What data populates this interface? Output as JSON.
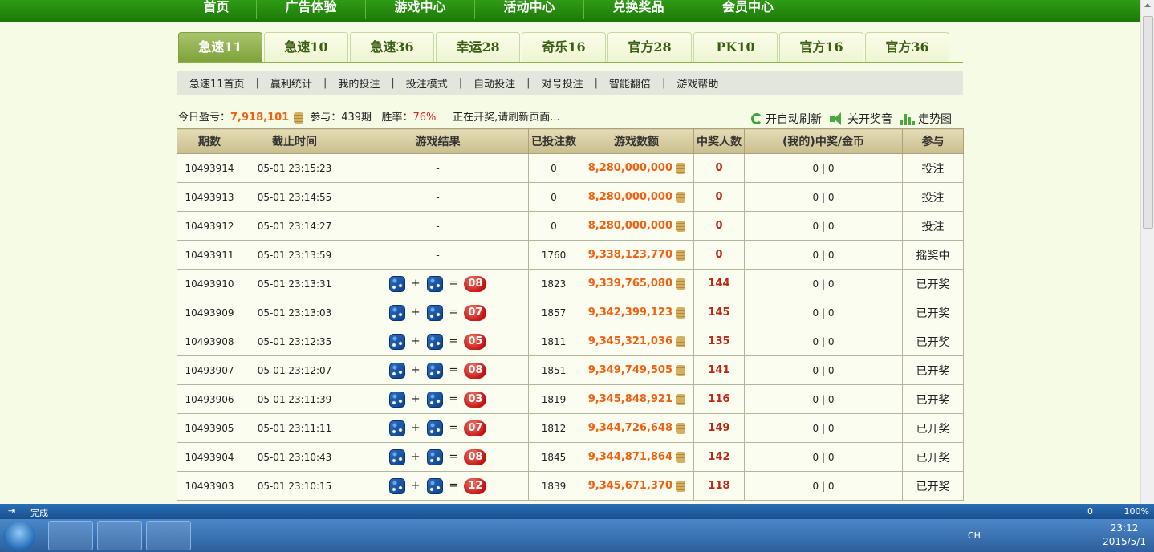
{
  "nav": [
    "首页",
    "广告体验",
    "游戏中心",
    "活动中心",
    "兑换奖品",
    "会员中心"
  ],
  "game_tabs": [
    "急速11",
    "急速10",
    "急速36",
    "幸运28",
    "奇乐16",
    "官方28",
    "PK10",
    "官方16",
    "官方36"
  ],
  "submenu": [
    "急速11首页",
    "赢利统计",
    "我的投注",
    "投注模式",
    "自动投注",
    "对号投注",
    "智能翻倍",
    "游戏帮助"
  ],
  "stats": {
    "label_profit": "今日盈亏：",
    "profit": "7,918,101",
    "label_join": "参与：",
    "join": "439期",
    "label_rate": "胜率：",
    "rate": "76%",
    "notice": "正在开奖,请刷新页面..."
  },
  "tools": {
    "refresh": "开自动刷新",
    "sound": "关开奖音",
    "trend": "走势图"
  },
  "table": {
    "headers": [
      "期数",
      "截止时间",
      "游戏结果",
      "已投注数",
      "游戏数额",
      "中奖人数",
      "(我的)中奖/金币",
      "参与"
    ],
    "rows": [
      {
        "id": "10493914",
        "time": "05-01 23:15:23",
        "result": "-",
        "bets": "0",
        "amount": "8,280,000,000",
        "winners": "0",
        "mine": "0 | 0",
        "status": "投注"
      },
      {
        "id": "10493913",
        "time": "05-01 23:14:55",
        "result": "-",
        "bets": "0",
        "amount": "8,280,000,000",
        "winners": "0",
        "mine": "0 | 0",
        "status": "投注"
      },
      {
        "id": "10493912",
        "time": "05-01 23:14:27",
        "result": "-",
        "bets": "0",
        "amount": "8,280,000,000",
        "winners": "0",
        "mine": "0 | 0",
        "status": "投注"
      },
      {
        "id": "10493911",
        "time": "05-01 23:13:59",
        "result": "-",
        "bets": "1760",
        "amount": "9,338,123,770",
        "winners": "0",
        "mine": "0 | 0",
        "status": "摇奖中"
      },
      {
        "id": "10493910",
        "time": "05-01 23:13:31",
        "result": "08",
        "bets": "1823",
        "amount": "9,339,765,080",
        "winners": "144",
        "mine": "0 | 0",
        "status": "已开奖"
      },
      {
        "id": "10493909",
        "time": "05-01 23:13:03",
        "result": "07",
        "bets": "1857",
        "amount": "9,342,399,123",
        "winners": "145",
        "mine": "0 | 0",
        "status": "已开奖"
      },
      {
        "id": "10493908",
        "time": "05-01 23:12:35",
        "result": "05",
        "bets": "1811",
        "amount": "9,345,321,036",
        "winners": "135",
        "mine": "0 | 0",
        "status": "已开奖"
      },
      {
        "id": "10493907",
        "time": "05-01 23:12:07",
        "result": "08",
        "bets": "1851",
        "amount": "9,349,749,505",
        "winners": "141",
        "mine": "0 | 0",
        "status": "已开奖"
      },
      {
        "id": "10493906",
        "time": "05-01 23:11:39",
        "result": "03",
        "bets": "1819",
        "amount": "9,345,848,921",
        "winners": "116",
        "mine": "0 | 0",
        "status": "已开奖"
      },
      {
        "id": "10493905",
        "time": "05-01 23:11:11",
        "result": "07",
        "bets": "1812",
        "amount": "9,344,726,648",
        "winners": "149",
        "mine": "0 | 0",
        "status": "已开奖"
      },
      {
        "id": "10493904",
        "time": "05-01 23:10:43",
        "result": "08",
        "bets": "1845",
        "amount": "9,344,871,864",
        "winners": "142",
        "mine": "0 | 0",
        "status": "已开奖"
      },
      {
        "id": "10493903",
        "time": "05-01 23:10:15",
        "result": "12",
        "bets": "1839",
        "amount": "9,345,671,370",
        "winners": "118",
        "mine": "0 | 0",
        "status": "已开奖"
      }
    ]
  },
  "statusbar": {
    "done": "完成",
    "zoom": "100%",
    "count": "0"
  },
  "taskbar": {
    "ime": "CH",
    "time": "23:12",
    "date": "2015/5/1"
  },
  "colors": {
    "nav_bg": "#1c7a06",
    "amount": "#f2600f",
    "winners": "#c0250f",
    "ball": "#c41212"
  },
  "icons": [
    "refresh-icon",
    "speaker-icon",
    "chart-icon",
    "coin-icon",
    "dice-icon",
    "windows-start-icon"
  ]
}
